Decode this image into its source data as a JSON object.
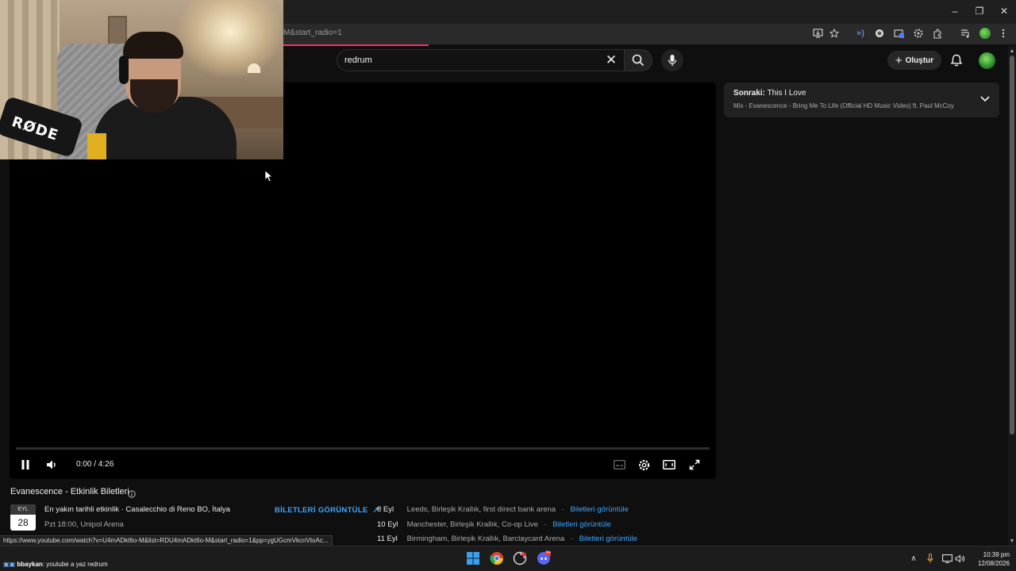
{
  "browser": {
    "url_fragment": "M&start_radio=1",
    "window_controls": {
      "minimize": "–",
      "restore": "❐",
      "close": "✕"
    },
    "extension_icons": [
      "install-icon",
      "star-icon",
      "audio-icon",
      "shield-icon",
      "tab-search-icon",
      "gear-icon",
      "puzzle-icon",
      "media-icon",
      "profile-icon",
      "more-icon"
    ]
  },
  "header": {
    "search_value": "redrum",
    "create_label": "Oluştur",
    "accent": "#ff0000"
  },
  "player": {
    "time": "0:00 / 4:26",
    "progress": 0
  },
  "up_next": {
    "prefix": "Sonraki:",
    "title": "This I Love",
    "subtitle": "Mix - Evanescence - Bring Me To Life (Official HD Music Video) ft. Paul McCoy"
  },
  "webcam": {
    "mic_brand": "RØDE"
  },
  "tickets": {
    "title": "Evanescence - Etkinlik Biletleri",
    "month": "EYL",
    "day": "28",
    "event_title": "En yakın tarihli etkinlik · Casalecchio di Reno BO, İtalya",
    "event_sub": "Pzt 18:00, Unipol Arena",
    "button": "BİLETLERİ GÖRÜNTÜLE",
    "events": [
      {
        "date": "8 Eyl",
        "place": "Leeds, Birleşik Krallık, first direct bank arena",
        "link": "Biletleri görüntüle"
      },
      {
        "date": "10 Eyl",
        "place": "Manchester, Birleşik Krallık, Co-op Live",
        "link": "Biletleri görüntüle"
      },
      {
        "date": "11 Eyl",
        "place": "Birmingham, Birleşik Krallık, Barclaycard Arena",
        "link": "Biletleri görüntüle"
      }
    ]
  },
  "status_url": "https://www.youtube.com/watch?v=U4mADkt6o-M&list=RDU4mADkt6o-M&start_radio=1&pp=ygUGcmVkcnVtoAc...",
  "taskbar": {
    "chat_user": "bbaykan",
    "chat_message": ": youtube a yaz redrum",
    "time": "10:39 pm",
    "date": "12/08/2026",
    "discord_badge": "9+"
  }
}
